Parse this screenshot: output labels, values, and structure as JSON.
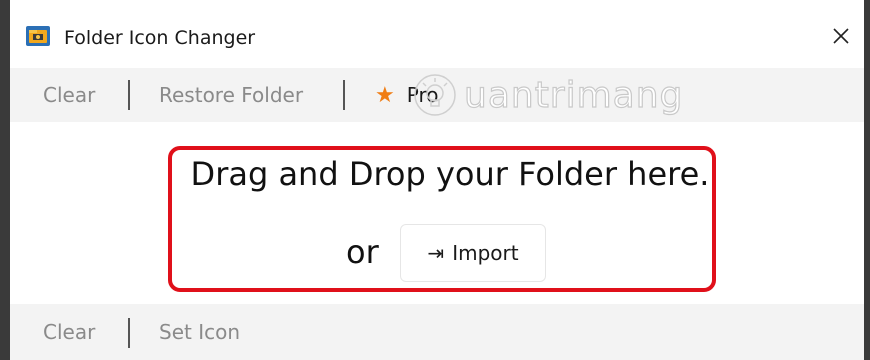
{
  "window": {
    "title": "Folder Icon Changer",
    "close_glyph": "✕"
  },
  "toolbar_top": {
    "clear_label": "Clear",
    "restore_label": "Restore Folder",
    "pro_label": "Pro",
    "star_glyph": "★"
  },
  "watermark": {
    "text": "uantrimang"
  },
  "drop_zone": {
    "prompt": "Drag and Drop your Folder here.",
    "or_label": "or",
    "import_label": "Import",
    "import_glyph": "⇥"
  },
  "toolbar_bottom": {
    "clear_label": "Clear",
    "set_icon_label": "Set Icon"
  },
  "colors": {
    "accent_star": "#f07d14",
    "highlight_border": "#e0101a",
    "toolbar_bg": "#f3f3f3"
  },
  "icons": [
    "folder-app-icon",
    "close-icon",
    "star-icon",
    "import-arrow-icon",
    "lightbulb-icon"
  ]
}
